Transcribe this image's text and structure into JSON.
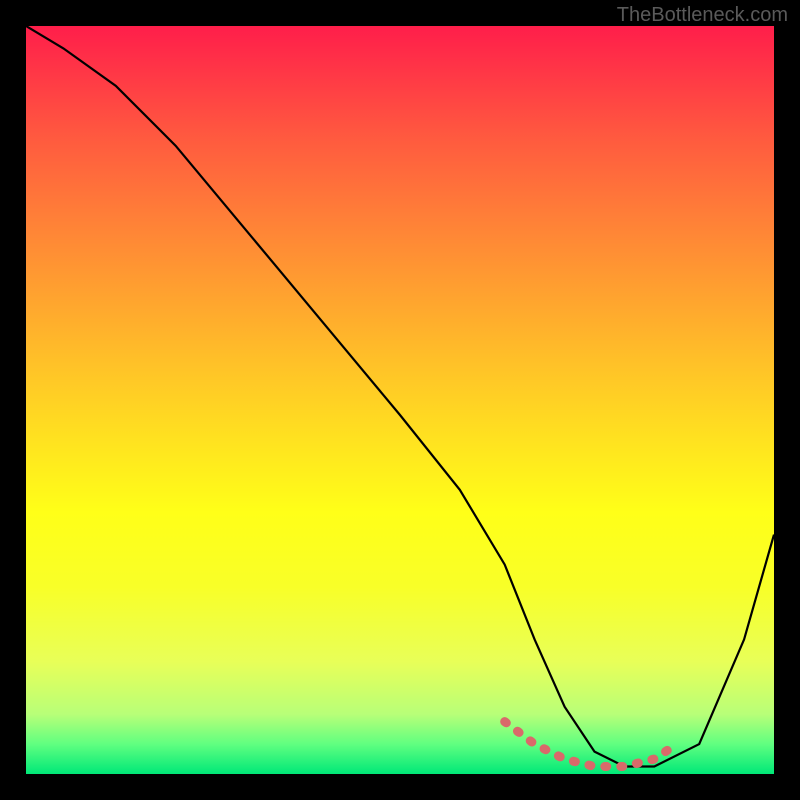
{
  "attribution": "TheBottleneck.com",
  "chart_data": {
    "type": "line",
    "title": "",
    "xlabel": "",
    "ylabel": "",
    "xlim": [
      0,
      100
    ],
    "ylim": [
      0,
      100
    ],
    "series": [
      {
        "name": "bottleneck-curve",
        "x": [
          0,
          5,
          12,
          20,
          30,
          40,
          50,
          58,
          64,
          68,
          72,
          76,
          80,
          84,
          90,
          96,
          100
        ],
        "values": [
          100,
          97,
          92,
          84,
          72,
          60,
          48,
          38,
          28,
          18,
          9,
          3,
          1,
          1,
          4,
          18,
          32
        ]
      }
    ],
    "optimal_zone": {
      "x": [
        64,
        68,
        72,
        76,
        80,
        84,
        87
      ],
      "values": [
        7,
        4,
        2,
        1,
        1,
        2,
        4
      ]
    },
    "gradient_stops": [
      {
        "pos": 0,
        "color": "#ff1e4a"
      },
      {
        "pos": 50,
        "color": "#ffd024"
      },
      {
        "pos": 100,
        "color": "#00e878"
      }
    ]
  }
}
